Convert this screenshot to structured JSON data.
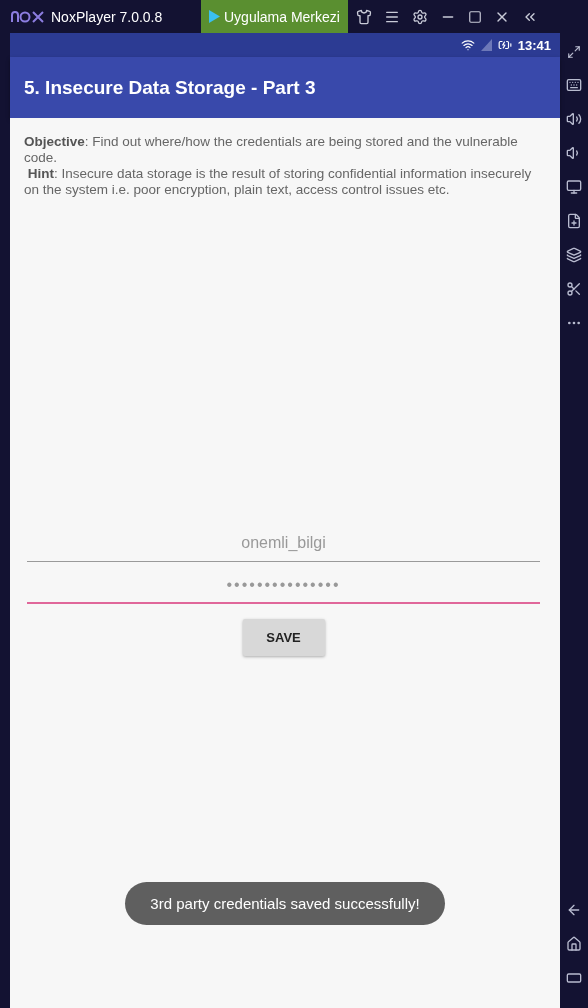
{
  "window": {
    "title": "NoxPlayer 7.0.0.8",
    "app_center": "Uygulama Merkezi"
  },
  "status_bar": {
    "time": "13:41"
  },
  "app_bar": {
    "title": "5. Insecure Data Storage - Part 3"
  },
  "description": "**Objective**: Find out where/how the credentials are being stored and the vulnerable code.\n **Hint**: Insecure data storage is the result of storing confidential information insecurely on the system i.e. poor encryption, plain text, access control issues etc.",
  "fields": [
    {
      "value": "onemli_bilgi",
      "focused": false,
      "kind": "text"
    },
    {
      "value": "•••••••••••••••",
      "focused": true,
      "kind": "password"
    }
  ],
  "save_button": "SAVE",
  "toast": "3rd party credentials saved successfully!"
}
